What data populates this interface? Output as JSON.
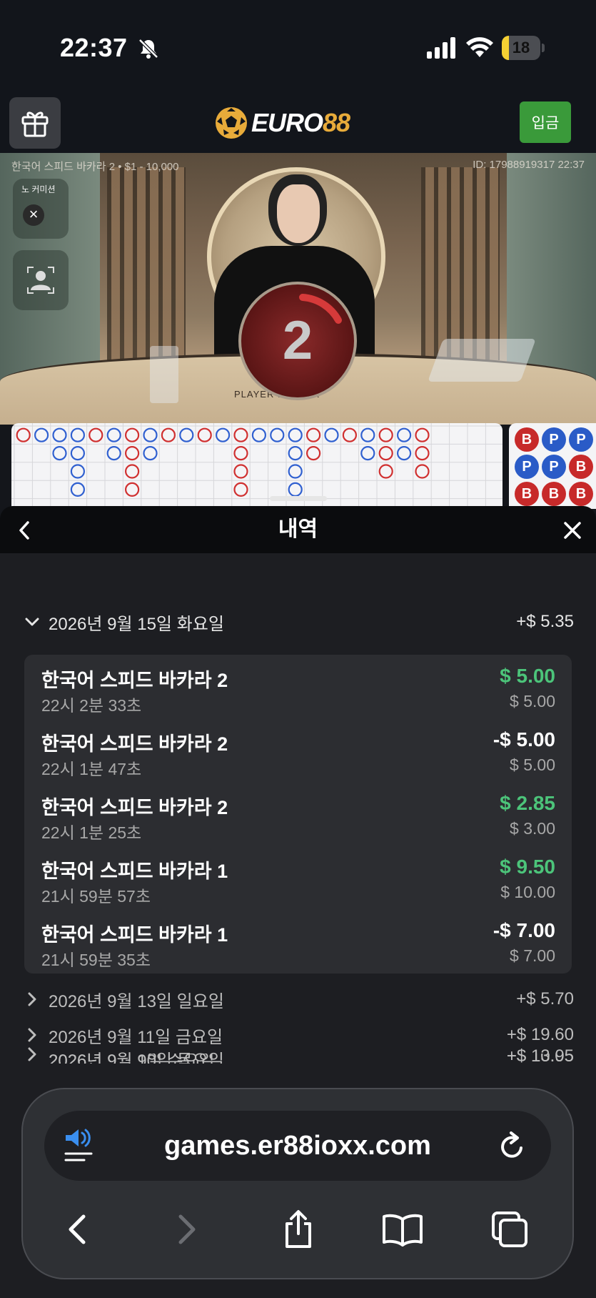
{
  "status_bar": {
    "time": "22:37",
    "battery_level": "18",
    "battery_fraction": 0.18,
    "icons": [
      "bell-off-icon",
      "signal-icon",
      "wifi-icon",
      "battery-icon"
    ]
  },
  "header": {
    "gift_icon": "gift-icon",
    "logo_part1": "EURO",
    "logo_part2": "88",
    "deposit_label": "입금",
    "colors": {
      "deposit": "#3a9a3a",
      "logo_accent": "#e8ab3a"
    }
  },
  "video": {
    "table_info": "한국어 스피드 바카라 2 • $1 - 10,000",
    "round_info": "ID: 17988919317 22:37",
    "no_commission_label": "노 커미션",
    "countdown": "2",
    "table_print": "PLAYER   BANKER"
  },
  "history": {
    "title": "내역",
    "expanded_day": {
      "label": "2026년 9월 15일 화요일",
      "total": "+$ 5.35"
    },
    "bets": [
      {
        "name": "한국어 스피드 바카라 2",
        "time": "22시 2분 33초",
        "result": "$ 5.00",
        "stake": "$ 5.00",
        "outcome": "win"
      },
      {
        "name": "한국어 스피드 바카라 2",
        "time": "22시 1분 47초",
        "result": "-$ 5.00",
        "stake": "$ 5.00",
        "outcome": "loss"
      },
      {
        "name": "한국어 스피드 바카라 2",
        "time": "22시 1분 25초",
        "result": "$ 2.85",
        "stake": "$ 3.00",
        "outcome": "win"
      },
      {
        "name": "한국어 스피드 바카라 1",
        "time": "21시 59분 57초",
        "result": "$ 9.50",
        "stake": "$ 10.00",
        "outcome": "win"
      },
      {
        "name": "한국어 스피드 바카라 1",
        "time": "21시 59분 35초",
        "result": "-$ 7.00",
        "stake": "$ 7.00",
        "outcome": "loss"
      }
    ],
    "collapsed_days": [
      {
        "label": "2026년 9월 13일 일요일",
        "total": "+$ 5.70"
      },
      {
        "label": "2026년 9월 11일 금요일",
        "total": "+$ 19.60"
      },
      {
        "label": "2026년 9월 10일 목요일",
        "total": "+$ 13.05"
      },
      {
        "label": "2026년 9월 9일 수요일",
        "total": "+$ 10.95"
      }
    ],
    "colors": {
      "win": "#4cc47a",
      "loss": "#ffffff"
    }
  },
  "roadmap": {
    "side_beads": [
      "B",
      "P",
      "B",
      "P",
      "P",
      "B",
      "P",
      "B",
      "B"
    ]
  },
  "browser": {
    "url": "games.er88ioxx.com",
    "icons": [
      "speaker-icon",
      "reload-icon",
      "back-icon",
      "forward-icon",
      "share-icon",
      "bookmarks-icon",
      "tabs-icon"
    ]
  }
}
